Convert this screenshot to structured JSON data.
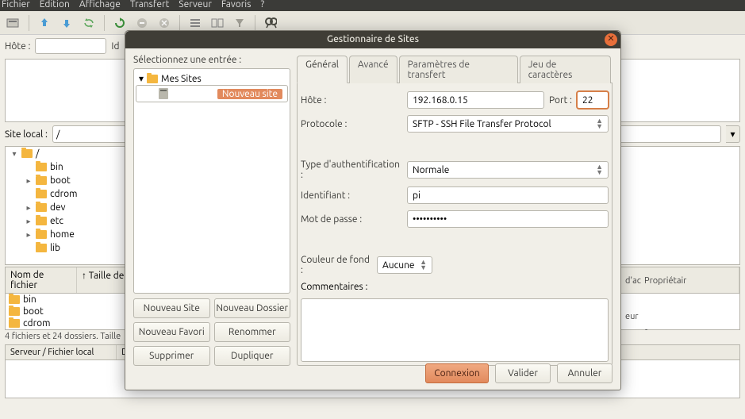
{
  "menubar": [
    "Fichier",
    "Édition",
    "Affichage",
    "Transfert",
    "Serveur",
    "Favoris",
    "?"
  ],
  "quick": {
    "host_lbl": "Hôte :",
    "id_lbl": "Id"
  },
  "local": {
    "label": "Site local :",
    "path": "/",
    "tree": [
      {
        "name": "/",
        "depth": 0,
        "exp": "▾"
      },
      {
        "name": "bin",
        "depth": 1,
        "exp": ""
      },
      {
        "name": "boot",
        "depth": 1,
        "exp": "▸"
      },
      {
        "name": "cdrom",
        "depth": 1,
        "exp": ""
      },
      {
        "name": "dev",
        "depth": 1,
        "exp": "▸"
      },
      {
        "name": "etc",
        "depth": 1,
        "exp": "▸"
      },
      {
        "name": "home",
        "depth": 1,
        "exp": "▸"
      },
      {
        "name": "lib",
        "depth": 1,
        "exp": ""
      }
    ]
  },
  "headers": {
    "name": "Nom de fichier",
    "size": "Taille de fic"
  },
  "files": [
    "bin",
    "boot",
    "cdrom"
  ],
  "status": "4 fichiers et 24 dossiers. Taille",
  "btm_headers": {
    "a": "Serveur / Fichier local",
    "b": "D"
  },
  "bg_visible": {
    "col_dac": "d'ac",
    "col_prop": "Propriétair",
    "row_eur": "eur",
    "row_dash": "-"
  },
  "dialog": {
    "title": "Gestionnaire de Sites",
    "select_lbl": "Sélectionnez une entrée :",
    "tree": {
      "root": "Mes Sites",
      "site": "Nouveau site"
    },
    "buttons": {
      "new_site": "Nouveau Site",
      "new_folder": "Nouveau Dossier",
      "new_fav": "Nouveau Favori",
      "rename": "Renommer",
      "delete": "Supprimer",
      "dup": "Dupliquer"
    },
    "tabs": [
      "Général",
      "Avancé",
      "Paramètres de transfert",
      "Jeu de caractères"
    ],
    "form": {
      "host_lbl": "Hôte :",
      "host": "192.168.0.15",
      "port_lbl": "Port :",
      "port": "22",
      "proto_lbl": "Protocole :",
      "proto": "SFTP - SSH File Transfer Protocol",
      "auth_lbl": "Type d'authentification :",
      "auth": "Normale",
      "user_lbl": "Identifiant :",
      "user": "pi",
      "pass_lbl": "Mot de passe :",
      "pass": "••••••••••",
      "bg_lbl": "Couleur de fond :",
      "bg": "Aucune",
      "comm_lbl": "Commentaires :"
    },
    "foot": {
      "connect": "Connexion",
      "validate": "Valider",
      "cancel": "Annuler"
    }
  }
}
